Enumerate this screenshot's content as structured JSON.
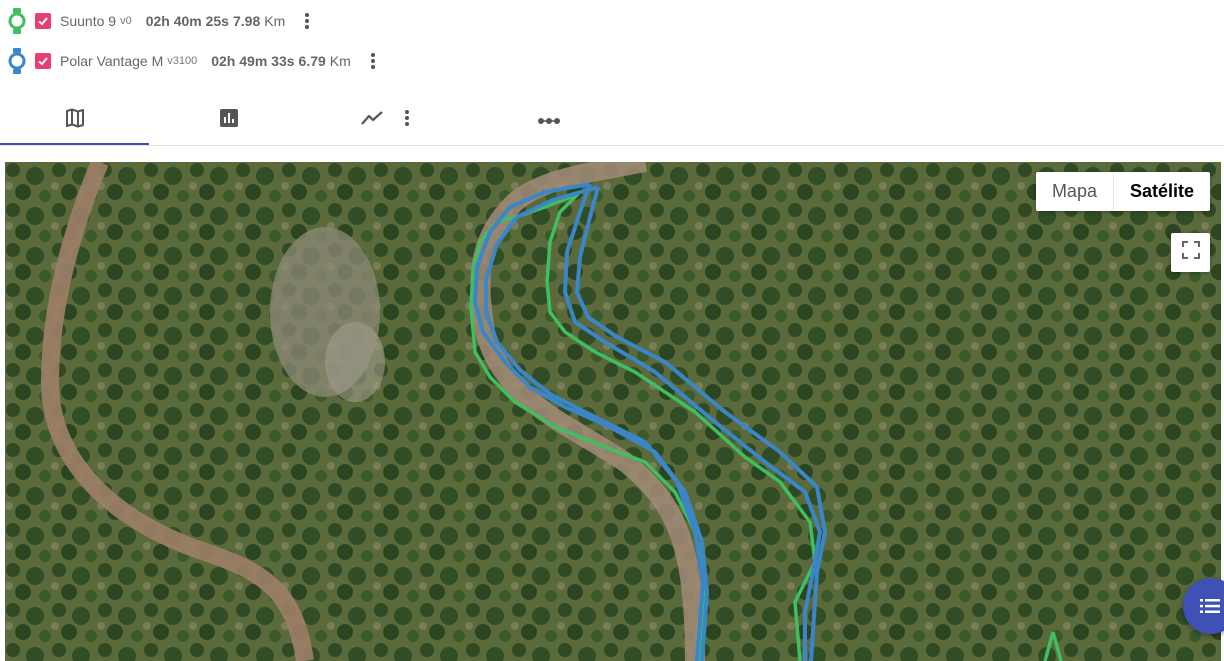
{
  "devices": [
    {
      "name": "Suunto 9",
      "version": "v0",
      "duration": "02h 40m 25s",
      "distance": "7.98",
      "unit": "Km",
      "color": "#3fbf5f",
      "checked": true
    },
    {
      "name": "Polar Vantage M",
      "version": "v3100",
      "duration": "02h 49m 33s",
      "distance": "6.79",
      "unit": "Km",
      "color": "#3a86c8",
      "checked": true
    }
  ],
  "tabs": [
    {
      "icon": "map-icon",
      "active": true
    },
    {
      "icon": "bar-chart-icon",
      "active": false
    },
    {
      "icon": "line-chart-icon",
      "active": false
    },
    {
      "icon": "laps-icon",
      "active": false
    }
  ],
  "map": {
    "type_options": [
      "Mapa",
      "Satélite"
    ],
    "selected_type": "Satélite"
  },
  "colors": {
    "accent": "#3f51b5",
    "checkbox": "#e83e72"
  }
}
